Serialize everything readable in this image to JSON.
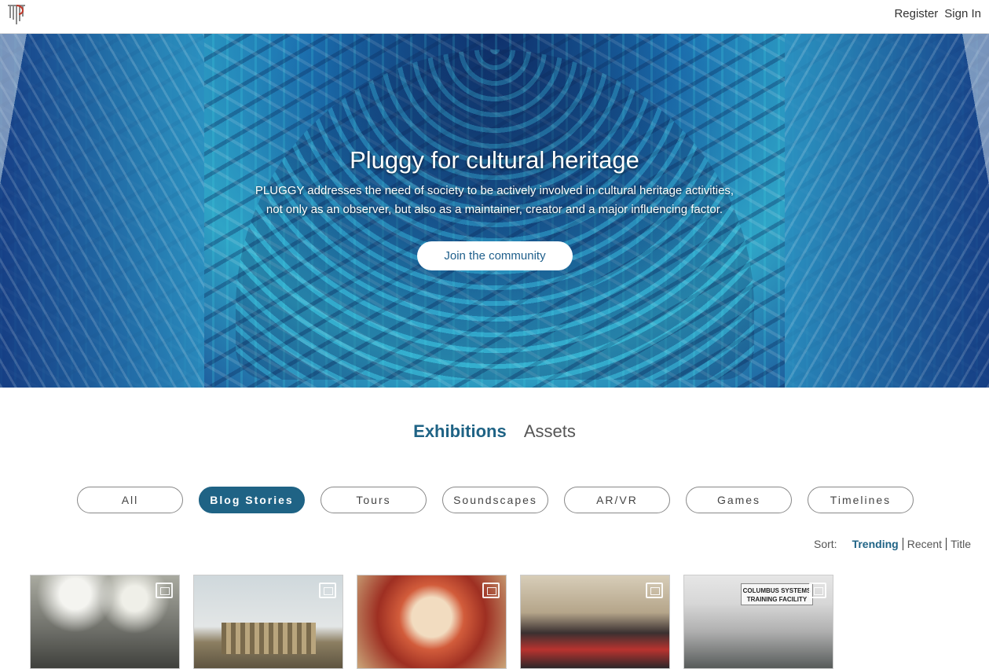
{
  "header": {
    "register": "Register",
    "sign_in": "Sign In"
  },
  "hero": {
    "title": "Pluggy for cultural heritage",
    "subtitle_line1": "PLUGGY addresses the need of society to be actively involved in cultural heritage activities,",
    "subtitle_line2": "not only as an observer, but also as a maintainer, creator and a major influencing factor.",
    "cta": "Join the community"
  },
  "tabs": [
    {
      "label": "Exhibitions",
      "active": true
    },
    {
      "label": "Assets",
      "active": false
    }
  ],
  "filters": [
    {
      "label": "All",
      "active": false
    },
    {
      "label": "Blog Stories",
      "active": true
    },
    {
      "label": "Tours",
      "active": false
    },
    {
      "label": "Soundscapes",
      "active": false
    },
    {
      "label": "AR/VR",
      "active": false
    },
    {
      "label": "Games",
      "active": false
    },
    {
      "label": "Timelines",
      "active": false
    }
  ],
  "sort": {
    "label": "Sort:",
    "options": [
      {
        "label": "Trending",
        "active": true
      },
      {
        "label": "Recent",
        "active": false
      },
      {
        "label": "Title",
        "active": false
      }
    ]
  },
  "cards": [
    {
      "icon": "exhibition-icon"
    },
    {
      "icon": "exhibition-icon"
    },
    {
      "icon": "exhibition-icon"
    },
    {
      "icon": "exhibition-icon"
    },
    {
      "icon": "exhibition-icon",
      "sign_line1": "COLUMBUS SYSTEMS",
      "sign_line2": "TRAINING FACILITY"
    }
  ],
  "colors": {
    "accent": "#1f6385"
  }
}
